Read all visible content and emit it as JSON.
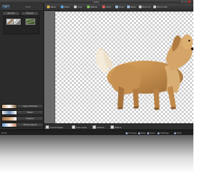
{
  "window": {
    "title": "Editor"
  },
  "left_panel": {
    "header_label": "Tools",
    "logo_text": "PF",
    "tabs": [
      "Recent",
      "Project"
    ],
    "buttons": [
      "Layer Shadow",
      "Mask",
      "Feather",
      "Photo Adjust",
      "Tool Options"
    ]
  },
  "toolbar": {
    "tools": [
      {
        "label": "Open",
        "icon": "folder-icon",
        "color": "#d9b24a"
      },
      {
        "label": "Save",
        "icon": "save-icon",
        "color": "#5aa0d8"
      },
      {
        "label": "Crop",
        "icon": "crop-icon",
        "color": "#c9c9c9"
      },
      {
        "label": "Resize",
        "icon": "resize-icon",
        "color": "#7fbf5a"
      },
      {
        "label": "Color",
        "icon": "palette-icon",
        "color": "#e05a5a"
      },
      {
        "label": "Undo",
        "icon": "undo-icon",
        "color": "#9ab8d8"
      },
      {
        "label": "Redo",
        "icon": "redo-icon",
        "color": "#9ab8d8"
      },
      {
        "label": "Zoom In",
        "icon": "zoom-in-icon",
        "color": "#cccccc"
      },
      {
        "label": "Zoom Out",
        "icon": "zoom-out-icon",
        "color": "#cccccc"
      }
    ]
  },
  "options_bar": {
    "items": [
      "Smart Edges",
      "Auto Snap",
      "Feather",
      "Refine"
    ]
  },
  "status_bar": {
    "left": "Done",
    "items": [
      "Preview",
      "New",
      "Save",
      "Settings",
      "Help"
    ]
  },
  "colors": {
    "accent": "#5aa0d8",
    "canvas_check": "#cfcfcf",
    "panel": "#2b2b2b"
  }
}
